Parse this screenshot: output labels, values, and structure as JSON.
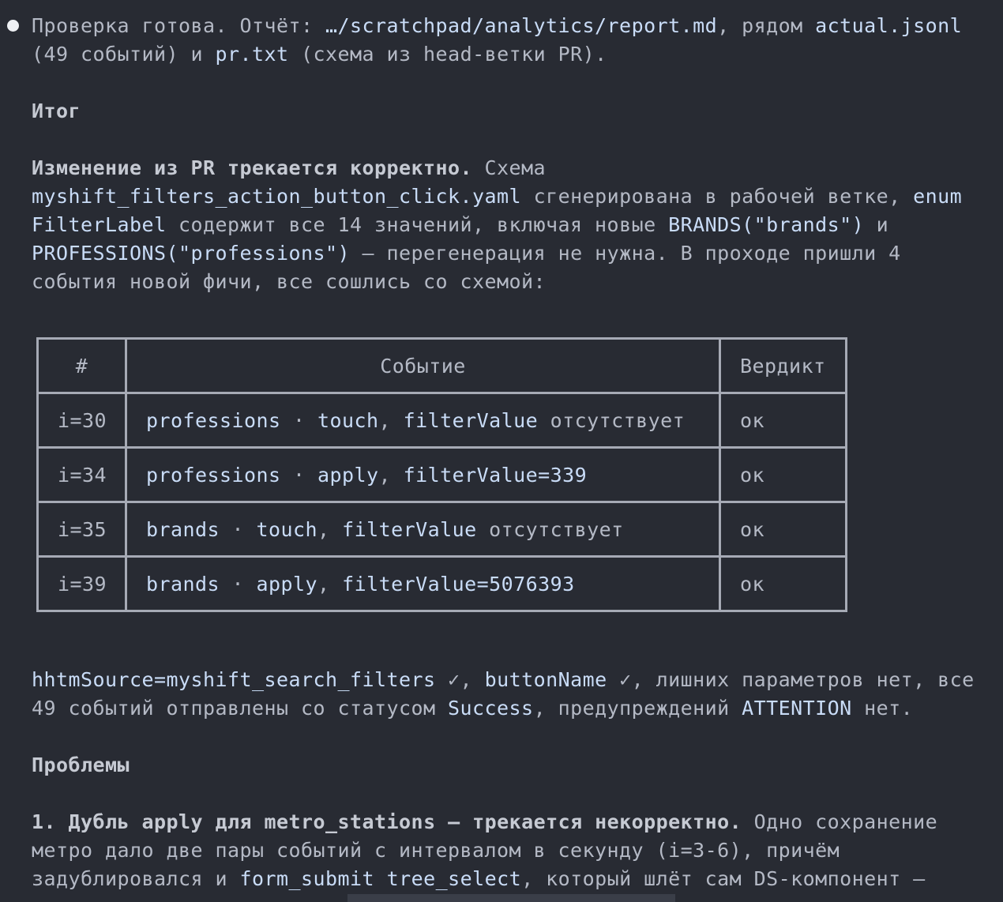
{
  "intro": {
    "line1": {
      "p1": "Проверка готова. Отчёт: ",
      "path": "…/scratchpad/analytics/report.md",
      "p2": ", рядом ",
      "file1": "actual.jsonl"
    },
    "line2": {
      "p1": "(49 событий) и ",
      "file2": "pr.txt",
      "p2": " (схема из head-ветки PR)."
    }
  },
  "summary": {
    "heading": "Итог",
    "line1": {
      "bold": "Изменение из PR трекается корректно.",
      "p1": " Схема"
    },
    "line2": {
      "yaml": "myshift_filters_action_button_click.yaml",
      "p1": " сгенерирована в рабочей ветке, ",
      "enum": "enum"
    },
    "line3": {
      "enum_name": "FilterLabel",
      "p1": " содержит все 14 значений, включая новые ",
      "brands": "BRANDS(\"brands\")",
      "p2": " и"
    },
    "line4": {
      "professions": "PROFESSIONS(\"professions\")",
      "p1": " — перегенерация не нужна. В проходе пришли 4"
    },
    "line5": "события новой фичи, все сошлись со схемой:"
  },
  "table": {
    "headers": [
      "#",
      "Событие",
      "Вердикт"
    ],
    "rows": [
      {
        "idx": "i=30",
        "name": "professions",
        "sep": " · ",
        "action": "touch",
        "comma": ", ",
        "field": "filterValue",
        "rest": " отсутствует",
        "verdict": "ок"
      },
      {
        "idx": "i=34",
        "name": "professions",
        "sep": " · ",
        "action": "apply",
        "comma": ", ",
        "field": "filterValue=339",
        "rest": "",
        "verdict": "ок"
      },
      {
        "idx": "i=35",
        "name": "brands",
        "sep": " · ",
        "action": "touch",
        "comma": ", ",
        "field": "filterValue",
        "rest": " отсутствует",
        "verdict": "ок"
      },
      {
        "idx": "i=39",
        "name": "brands",
        "sep": " · ",
        "action": "apply",
        "comma": ", ",
        "field": "filterValue=5076393",
        "rest": "",
        "verdict": "ок"
      }
    ]
  },
  "params": {
    "line1": {
      "src": "hhtmSource=myshift_search_filters",
      "p1": " ✓, ",
      "btn": "buttonName",
      "p2": " ✓, лишних параметров нет, все"
    },
    "line2": {
      "p1": "49 событий отправлены со статусом ",
      "status": "Success",
      "p2": ", предупреждений ",
      "attention": "ATTENTION",
      "p3": " нет."
    }
  },
  "problems": {
    "heading": "Проблемы",
    "line1": {
      "num": "1. Дубль ",
      "apply": "apply",
      "mid": " для ",
      "metro": "metro_stations",
      "bold_tail": " — трекается некорректно.",
      "p1": " Одно сохранение"
    },
    "line2": "метро дало две пары событий с интервалом в секунду (i=3-6), причём",
    "line3": {
      "p1": "задублировался и ",
      "form": "form_submit",
      "sp": " ",
      "tree": "tree_select",
      "p2": ", который шлёт сам DS-компонент —"
    }
  }
}
